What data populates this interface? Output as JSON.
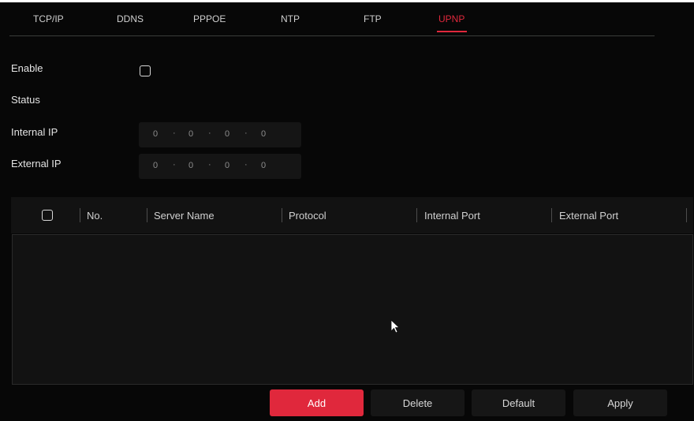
{
  "tabs": [
    {
      "label": "TCP/IP"
    },
    {
      "label": "DDNS"
    },
    {
      "label": "PPPOE"
    },
    {
      "label": "NTP"
    },
    {
      "label": "FTP"
    },
    {
      "label": "UPNP",
      "active": true
    }
  ],
  "form": {
    "enable_label": "Enable",
    "enable_checked": false,
    "status_label": "Status",
    "status_value": "",
    "internal_ip_label": "Internal IP",
    "internal_ip": [
      "0",
      "0",
      "0",
      "0"
    ],
    "external_ip_label": "External IP",
    "external_ip": [
      "0",
      "0",
      "0",
      "0"
    ]
  },
  "table": {
    "columns": [
      "No.",
      "Server Name",
      "Protocol",
      "Internal Port",
      "External Port"
    ],
    "rows": []
  },
  "buttons": {
    "add": "Add",
    "delete": "Delete",
    "default": "Default",
    "apply": "Apply"
  },
  "colors": {
    "accent": "#e0283c",
    "background": "#070707",
    "panel": "#121212"
  },
  "icons": {
    "pointer": "mouse-pointer-icon"
  }
}
